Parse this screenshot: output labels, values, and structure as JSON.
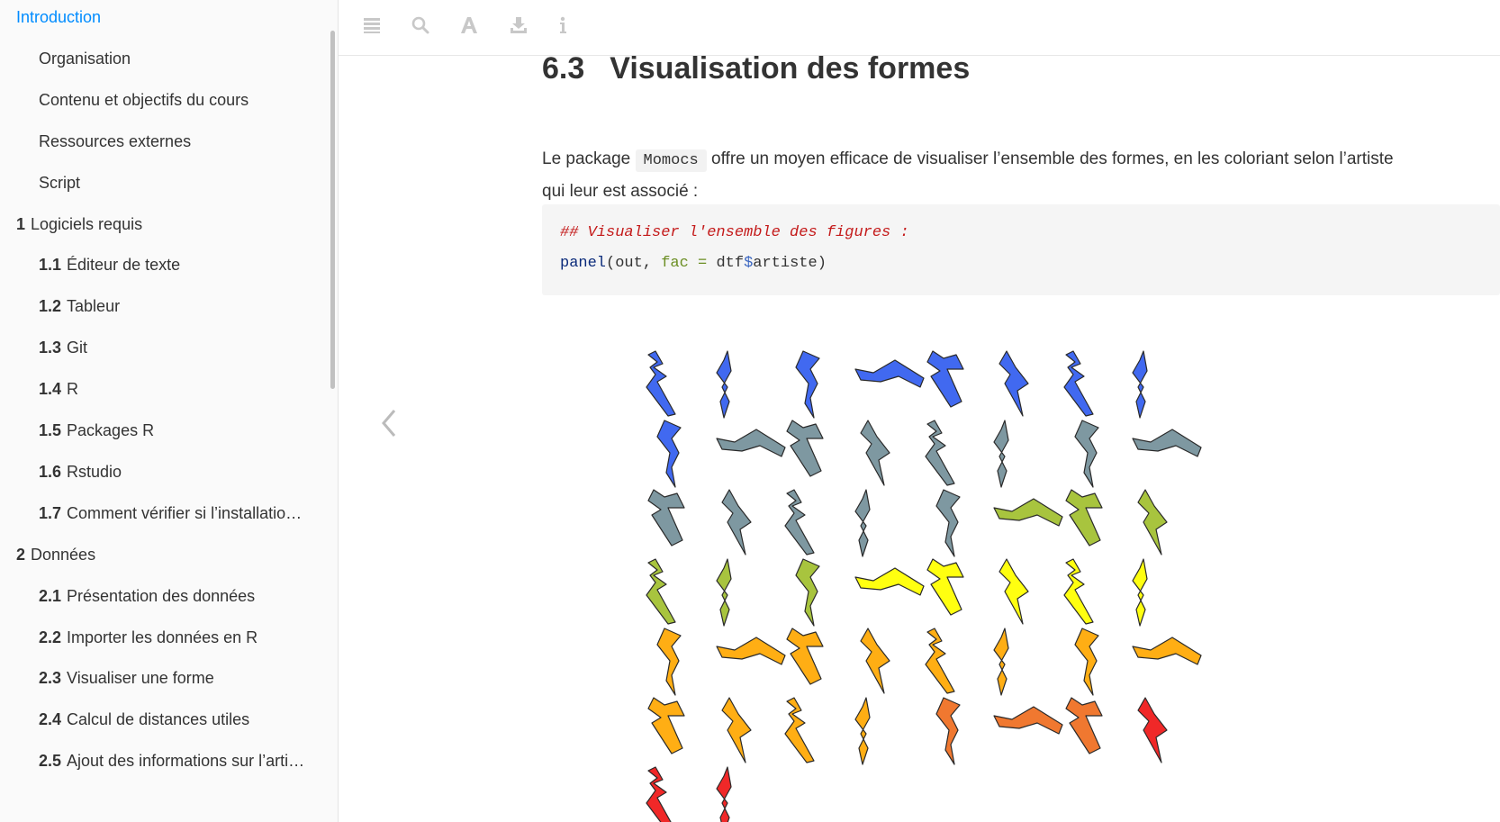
{
  "sidebar": {
    "items": [
      {
        "num": "",
        "label": "Introduction",
        "level": 1,
        "active": true
      },
      {
        "num": "",
        "label": "Organisation",
        "level": 2
      },
      {
        "num": "",
        "label": "Contenu et objectifs du cours",
        "level": 2
      },
      {
        "num": "",
        "label": "Ressources externes",
        "level": 2
      },
      {
        "num": "",
        "label": "Script",
        "level": 2
      },
      {
        "num": "1",
        "label": "Logiciels requis",
        "level": 1
      },
      {
        "num": "1.1",
        "label": "Éditeur de texte",
        "level": 2
      },
      {
        "num": "1.2",
        "label": "Tableur",
        "level": 2
      },
      {
        "num": "1.3",
        "label": "Git",
        "level": 2
      },
      {
        "num": "1.4",
        "label": "R",
        "level": 2
      },
      {
        "num": "1.5",
        "label": "Packages R",
        "level": 2
      },
      {
        "num": "1.6",
        "label": "Rstudio",
        "level": 2
      },
      {
        "num": "1.7",
        "label": "Comment vérifier si l’installatio…",
        "level": 2
      },
      {
        "num": "2",
        "label": "Données",
        "level": 1
      },
      {
        "num": "2.1",
        "label": "Présentation des données",
        "level": 2
      },
      {
        "num": "2.2",
        "label": "Importer les données en R",
        "level": 2
      },
      {
        "num": "2.3",
        "label": "Visualiser une forme",
        "level": 2
      },
      {
        "num": "2.4",
        "label": "Calcul de distances utiles",
        "level": 2
      },
      {
        "num": "2.5",
        "label": "Ajout des informations sur l’arti…",
        "level": 2
      }
    ]
  },
  "toolbar": {
    "icons": [
      "menu-icon",
      "search-icon",
      "font-icon",
      "download-icon",
      "info-icon"
    ]
  },
  "nav": {
    "prev_icon": "chevron-left-icon"
  },
  "main": {
    "section_number": "6.3",
    "section_title": "Visualisation des formes",
    "para_before": "Le package",
    "para_code": "Momocs",
    "para_after": "offre un moyen efficace de visualiser l’ensemble des formes, en les coloriant selon l’artiste qui leur est associé :",
    "code": {
      "comment": "## Visualiser l'ensemble des figures :",
      "fn": "panel",
      "open": "(out, ",
      "arg": "fac",
      "op": " = ",
      "obj": "dtf",
      "dollar": "$",
      "field": "artiste",
      "close": ")"
    }
  },
  "colors": {
    "accent": "#008cff",
    "blue": "#4169f0",
    "slate": "#7e98a1",
    "olive": "#a8c43e",
    "yellow": "#ffff10",
    "orange": "#ffae14",
    "redorange": "#f07830",
    "red": "#f02828"
  },
  "figure": {
    "rows": [
      [
        "blue",
        "blue",
        "blue",
        "blue",
        "blue",
        "blue",
        "blue",
        "blue"
      ],
      [
        "blue",
        "slate",
        "slate",
        "slate",
        "slate",
        "slate",
        "slate",
        "slate"
      ],
      [
        "slate",
        "slate",
        "slate",
        "slate",
        "slate",
        "olive",
        "olive",
        "olive"
      ],
      [
        "olive",
        "olive",
        "olive",
        "yellow",
        "yellow",
        "yellow",
        "yellow",
        "yellow"
      ],
      [
        "orange",
        "orange",
        "orange",
        "orange",
        "orange",
        "orange",
        "orange",
        "orange"
      ],
      [
        "orange",
        "orange",
        "orange",
        "orange",
        "redorange",
        "redorange",
        "redorange",
        "red"
      ],
      [
        "red",
        "red"
      ]
    ]
  }
}
